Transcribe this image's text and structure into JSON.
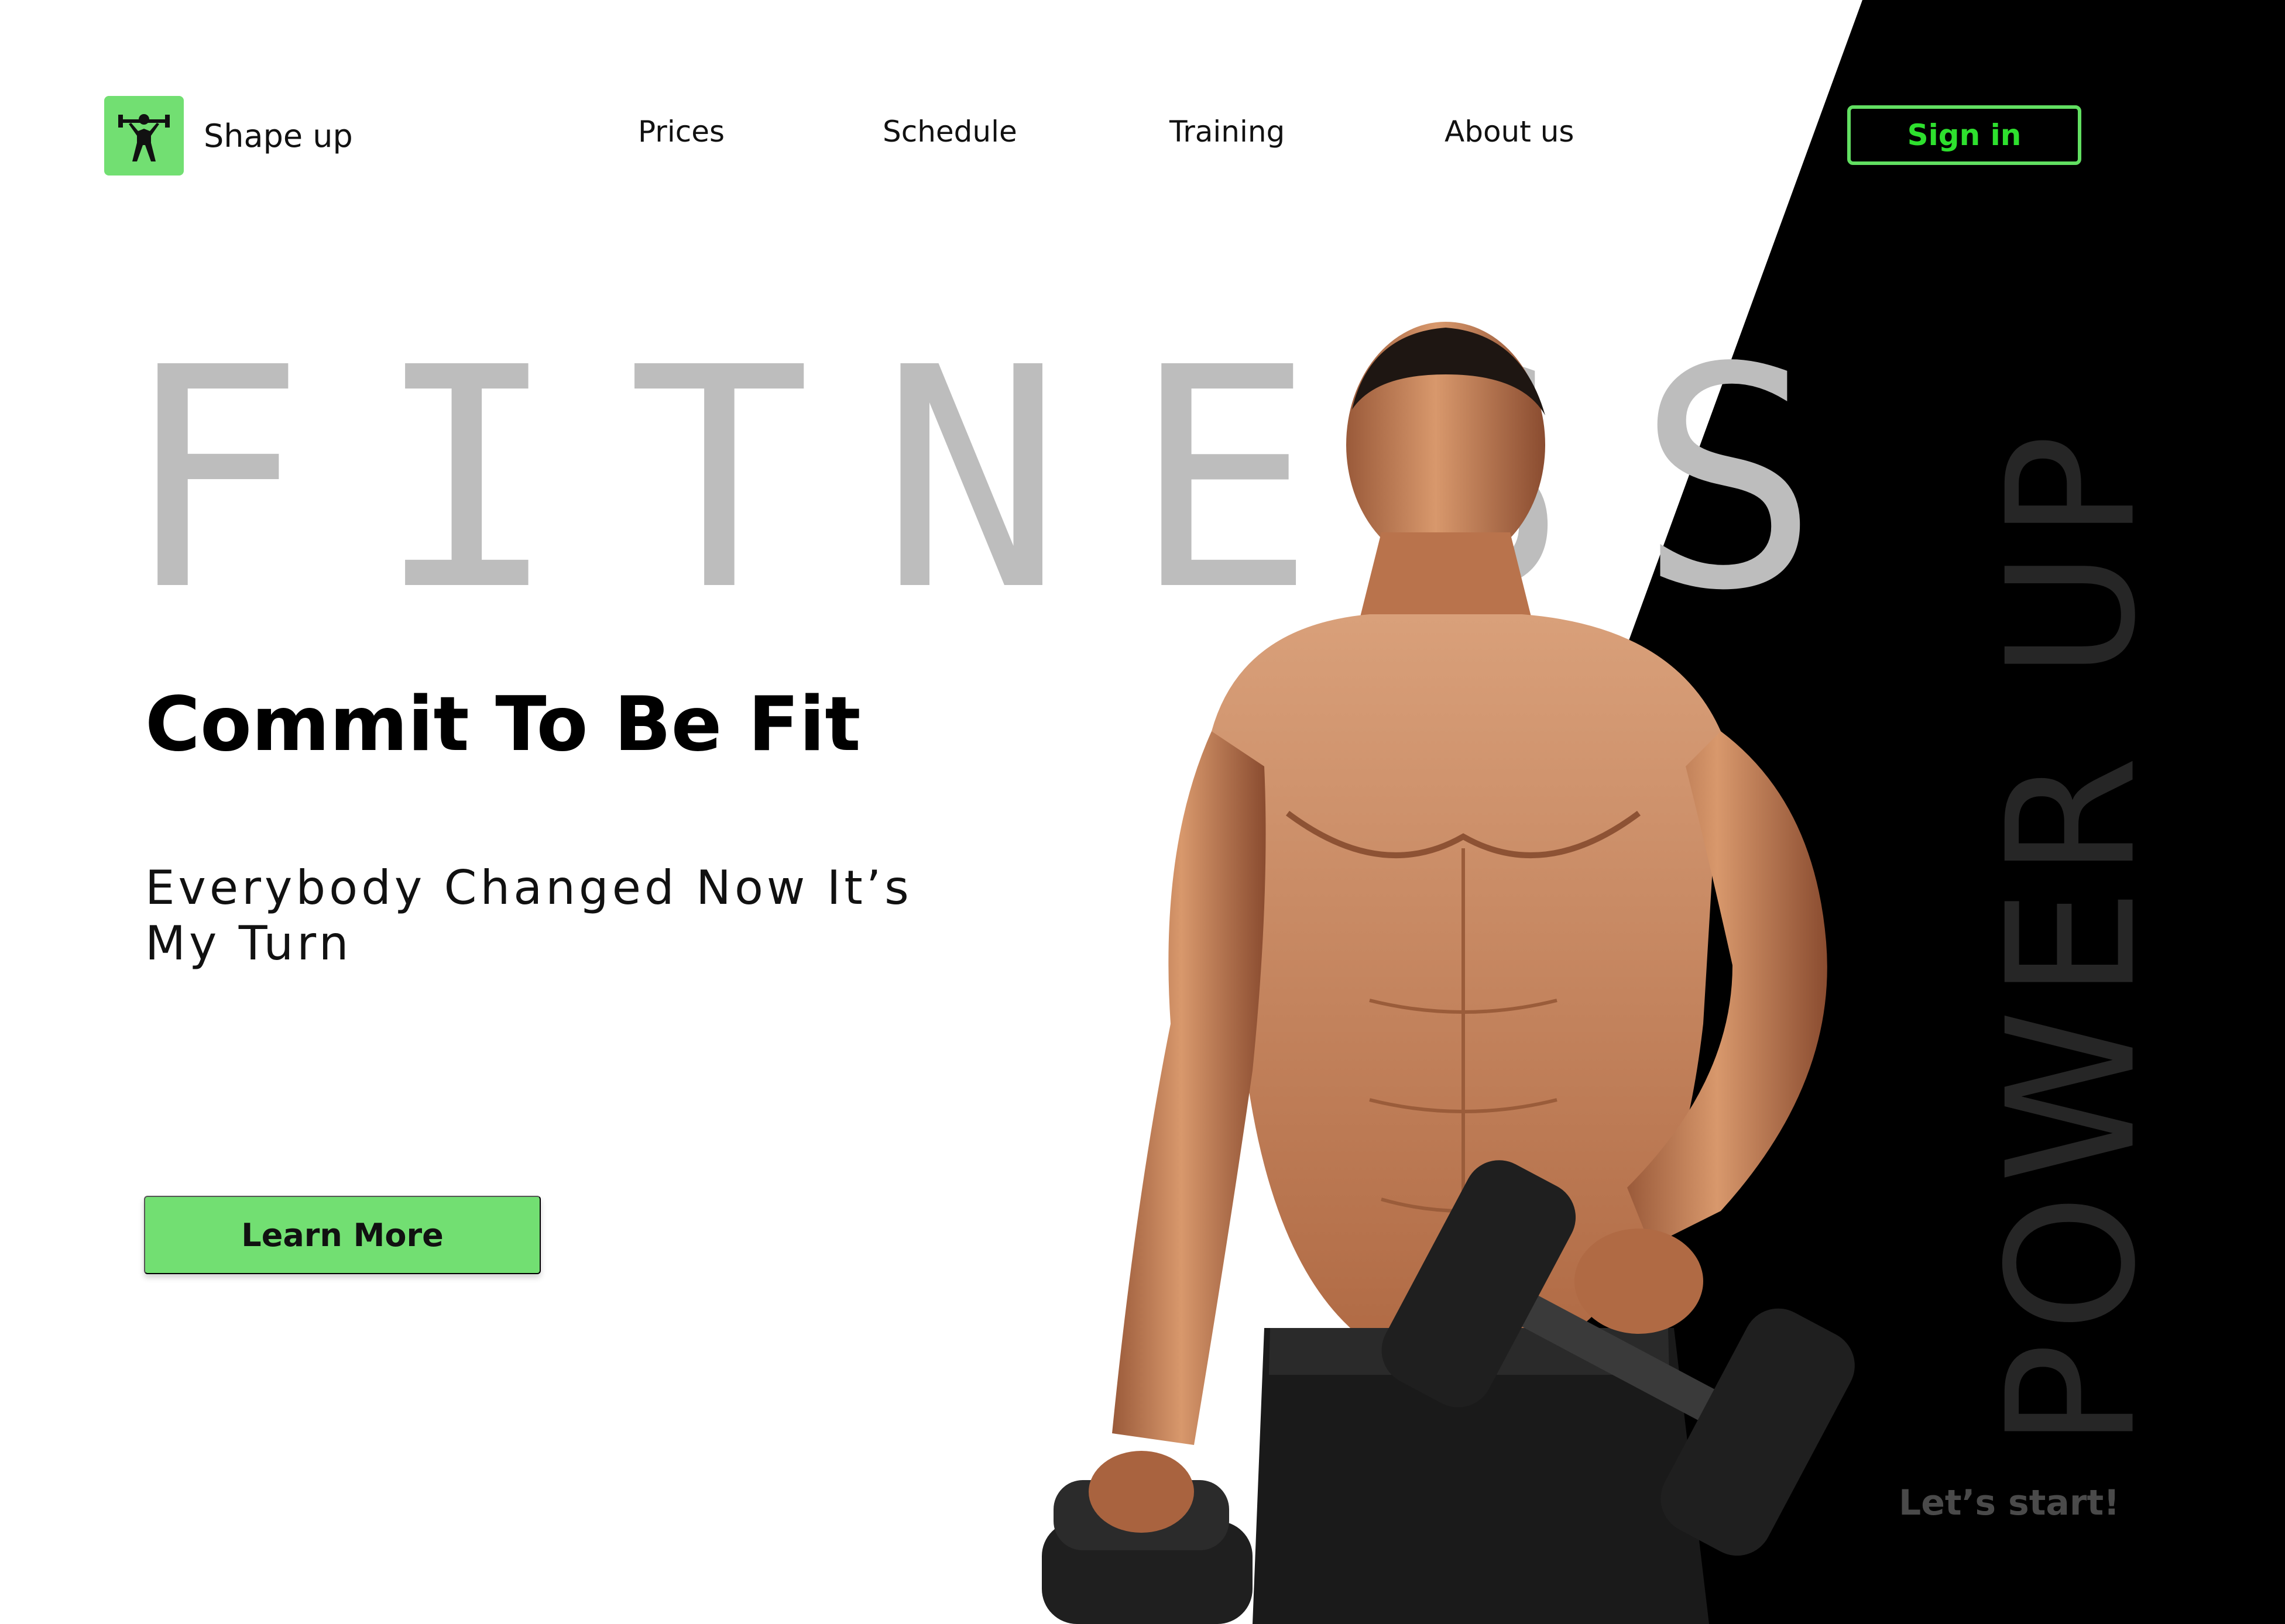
{
  "brand": {
    "name": "Shape up",
    "logo_icon": "weightlifter-icon",
    "accent_color": "#72df72"
  },
  "nav": {
    "items": [
      {
        "label": "Prices"
      },
      {
        "label": "Schedule"
      },
      {
        "label": "Training"
      },
      {
        "label": "About us"
      }
    ]
  },
  "header": {
    "signin_label": "Sign in",
    "signin_color": "#2ee02e"
  },
  "hero": {
    "background_word": "FITNESS",
    "headline": "Commit To Be Fit",
    "subline": "Everybody Changed Now It’s My Turn",
    "cta_label": "Learn More",
    "image": "muscular-man-with-dumbbells"
  },
  "side": {
    "vertical_text": "POWER UP",
    "cta_label": "Let’s start!",
    "panel_color": "#000000"
  }
}
